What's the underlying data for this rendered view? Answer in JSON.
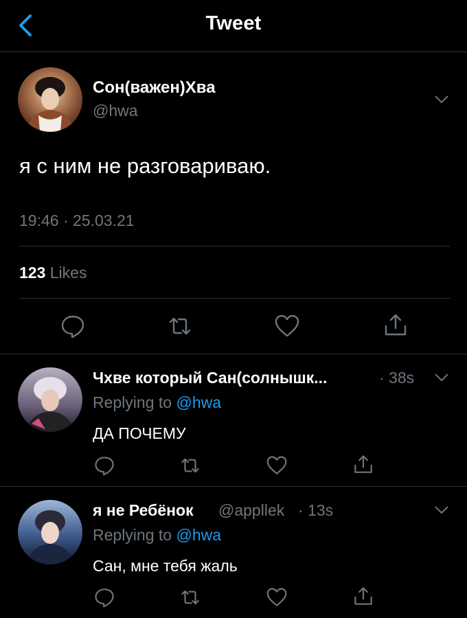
{
  "header": {
    "title": "Tweet"
  },
  "main_tweet": {
    "name": "Сон(важен)Хва",
    "handle": "@hwa",
    "text": "я с ним не разговариваю.",
    "time": "19:46 · 25.03.21",
    "likes_count": "123",
    "likes_label": "Likes"
  },
  "replies": [
    {
      "name": "Чхве который Сан(солнышк...",
      "handle": "",
      "time": "· 38s",
      "replying_prefix": "Replying to",
      "replying_to": "@hwa",
      "text": "ДА ПОЧЕМУ"
    },
    {
      "name": "я не Ребёнок",
      "handle": "@appllek",
      "time": "· 13s",
      "replying_prefix": "Replying to",
      "replying_to": "@hwa",
      "text": "Сан, мне тебя жаль"
    }
  ],
  "icons": {
    "back": "chevron-left-icon",
    "menu": "chevron-down-icon",
    "reply": "speech-bubble-icon",
    "retweet": "retweet-arrows-icon",
    "like": "heart-icon",
    "share": "share-upload-icon"
  },
  "colors": {
    "accent": "#1d9bf0",
    "muted": "#6e767d",
    "background": "#000000"
  }
}
